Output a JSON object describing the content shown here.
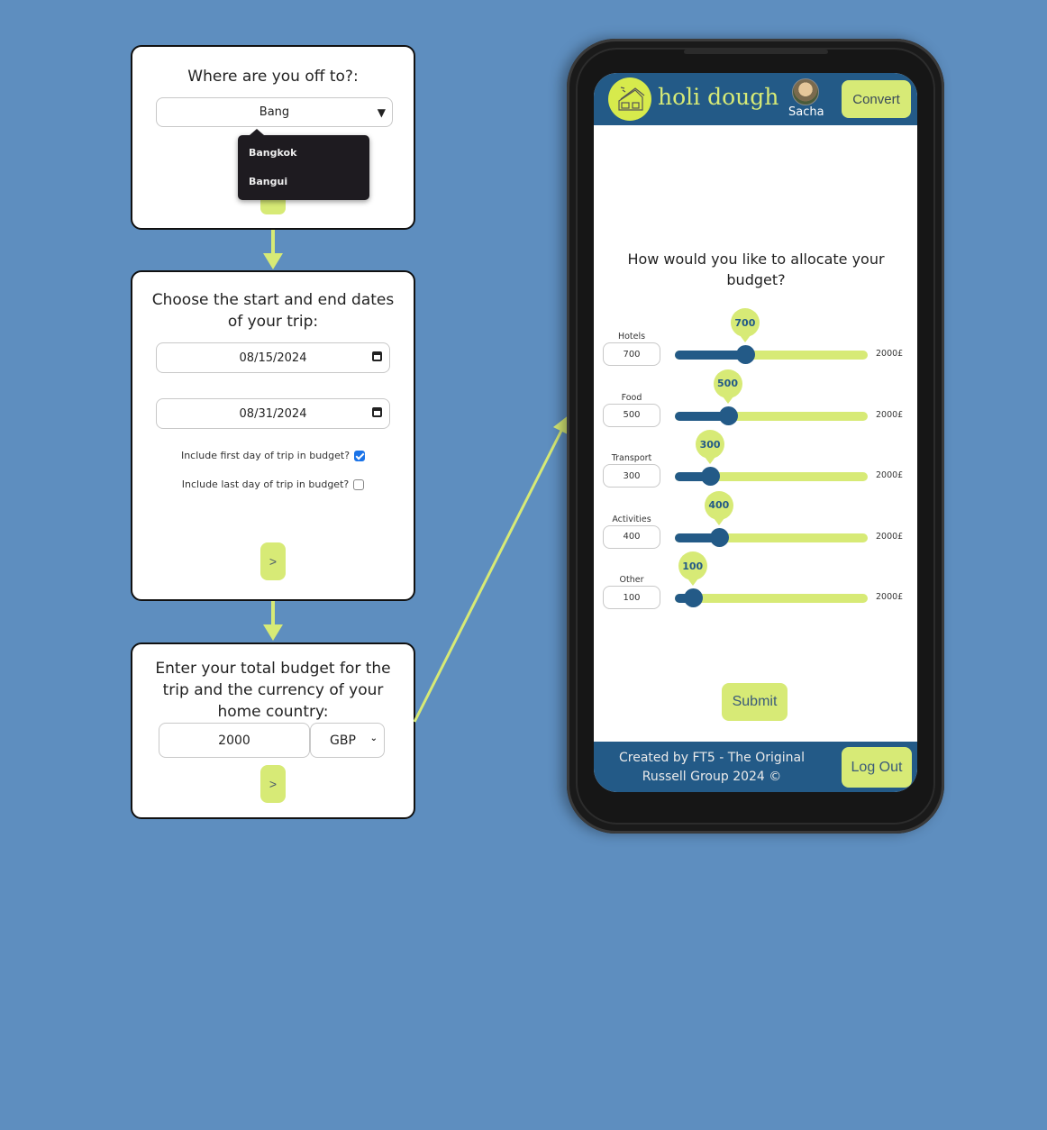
{
  "step1": {
    "title": "Where are you off to?:",
    "destination_value": "Bang",
    "suggestions": [
      "Bangkok",
      "Bangui"
    ]
  },
  "step2": {
    "title": "Choose the start and end dates of your trip:",
    "start_date": "08/15/2024",
    "end_date": "08/31/2024",
    "include_first_label": "Include first day of trip in budget?",
    "include_first_checked": true,
    "include_last_label": "Include last day of trip in budget?",
    "include_last_checked": false,
    "next_label": ">"
  },
  "step3": {
    "title": "Enter your total budget for the trip and the currency of your home country:",
    "budget_value": "2000",
    "currency": "GBP",
    "next_label": ">"
  },
  "phone": {
    "brand": "holi dough",
    "user_name": "Sacha",
    "convert_label": "Convert",
    "question": "How would you like to allocate your budget?",
    "max_label": "2000£",
    "max_value": 2000,
    "categories": [
      {
        "label": "Hotels",
        "value": 700
      },
      {
        "label": "Food",
        "value": 500
      },
      {
        "label": "Transport",
        "value": 300
      },
      {
        "label": "Activities",
        "value": 400
      },
      {
        "label": "Other",
        "value": 100
      }
    ],
    "submit_label": "Submit",
    "footer_text": "Created by FT5 - The Original Russell Group 2024 ©",
    "logout_label": "Log Out"
  },
  "colors": {
    "background": "#5e8ebf",
    "accent": "#d7ea76",
    "primary": "#235a87"
  }
}
